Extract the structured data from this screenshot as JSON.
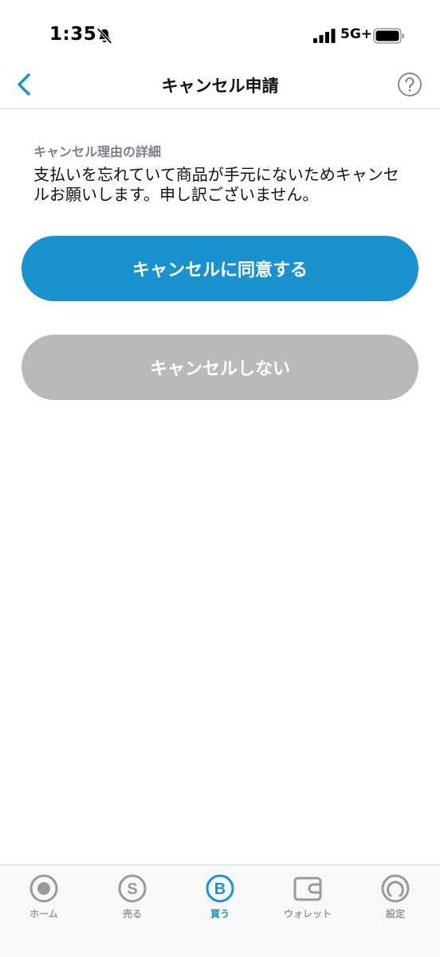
{
  "status_bar": {
    "time": "1:35",
    "network": "5G+"
  },
  "header": {
    "title": "キャンセル申請"
  },
  "content": {
    "reason_label": "キャンセル理由の詳細",
    "reason_text": "支払いを忘れていて商品が手元にないためキャンセルお願いします。申し訳ございません。"
  },
  "buttons": {
    "agree_label": "キャンセルに同意する",
    "decline_label": "キャンセルしない"
  },
  "tabs": [
    {
      "label": "ホーム",
      "icon": "home-icon"
    },
    {
      "label": "売る",
      "icon": "sell-icon"
    },
    {
      "label": "買う",
      "icon": "buy-icon",
      "active": true
    },
    {
      "label": "ウォレット",
      "icon": "wallet-icon"
    },
    {
      "label": "設定",
      "icon": "settings-icon"
    }
  ],
  "colors": {
    "accent": "#1a92d0",
    "disabled": "#b9b9b9",
    "label_gray": "#7b7f8c",
    "tab_inactive": "#9a9a9a"
  }
}
